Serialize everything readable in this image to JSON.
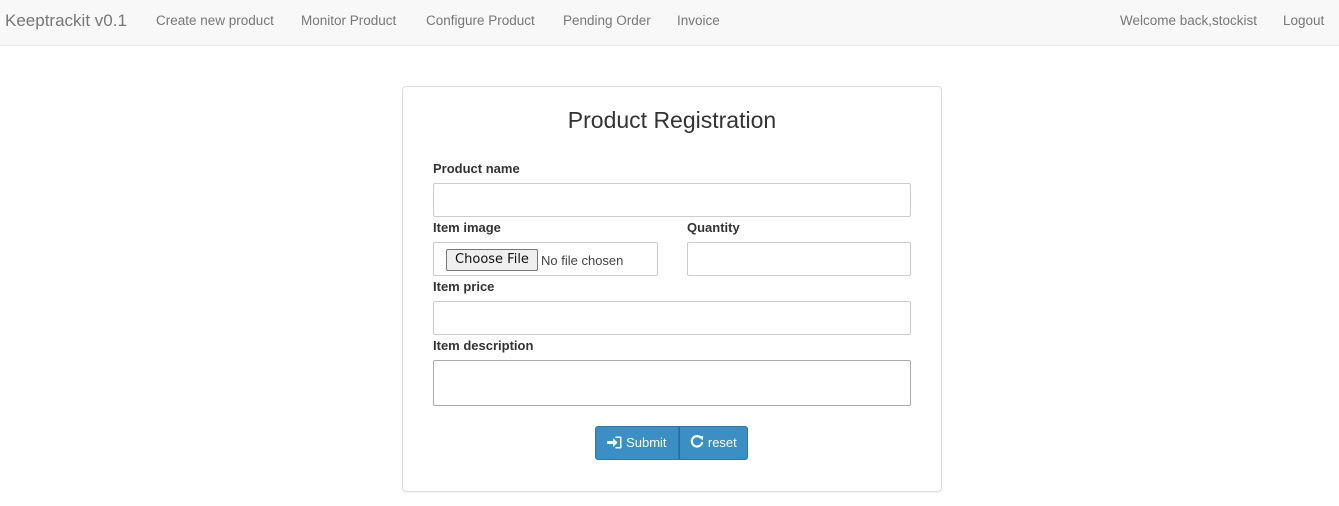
{
  "navbar": {
    "brand": "Keeptrackit v0.1",
    "links": [
      "Create new product",
      "Monitor Product",
      "Configure Product",
      "Pending Order",
      "Invoice"
    ],
    "welcome": "Welcome back,stockist",
    "logout": "Logout"
  },
  "form": {
    "title": "Product Registration",
    "product_name_label": "Product name",
    "product_name_value": "",
    "item_image_label": "Item image",
    "choose_file_label": "Choose File",
    "file_status": "No file chosen",
    "quantity_label": "Quantity",
    "quantity_value": "",
    "item_price_label": "Item price",
    "item_price_value": "",
    "item_description_label": "Item description",
    "item_description_value": "",
    "submit_label": "Submit",
    "reset_label": "reset"
  },
  "colors": {
    "navbar_bg": "#f8f8f8",
    "button_primary": "#3a8fc4"
  },
  "icons": {
    "submit_icon": "sign-in-icon",
    "reset_icon": "refresh-icon"
  }
}
